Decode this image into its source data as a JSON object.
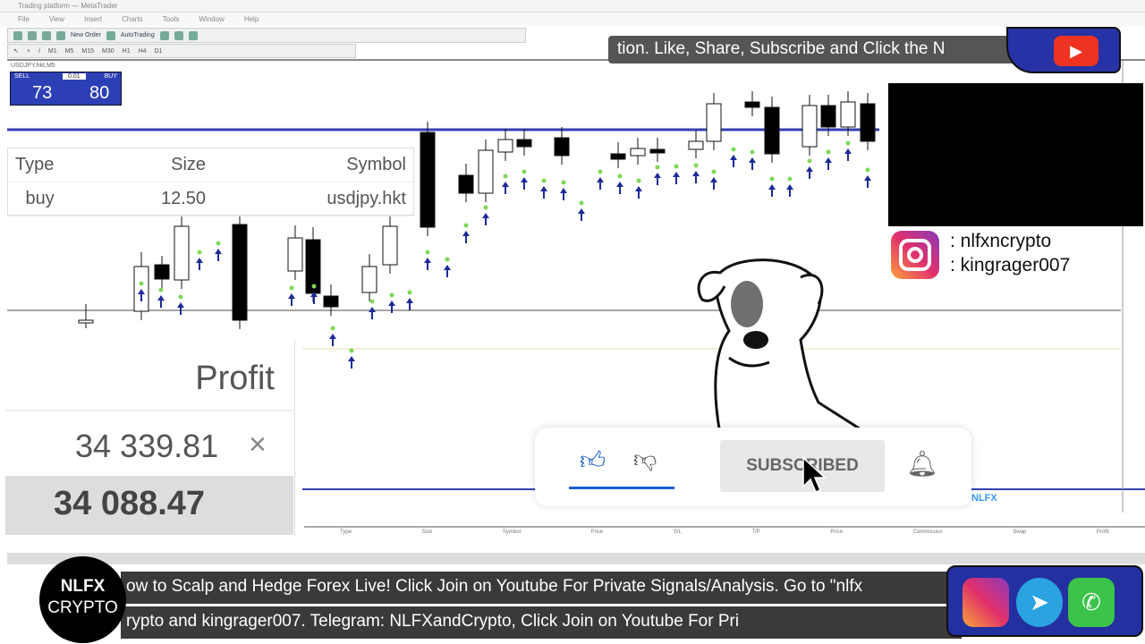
{
  "window": {
    "title": "Trading platform — MetaTrader",
    "menu": [
      "File",
      "View",
      "Insert",
      "Charts",
      "Tools",
      "Window",
      "Help"
    ]
  },
  "toolbar": {
    "new_order": "New Order",
    "autotrading": "AutoTrading",
    "timeframes": [
      "M1",
      "M5",
      "M15",
      "M30",
      "H1",
      "H4",
      "D1"
    ]
  },
  "chart": {
    "symbol_line": "USDJPY.hkt,M5",
    "sell_label": "SELL",
    "buy_label": "BUY",
    "lot": "0.01",
    "sell_price": "73",
    "buy_price": "80",
    "colors": {
      "bull": "#ffffff",
      "bear": "#000000",
      "arrow": "#1c2a9a",
      "arrow_tip": "#7ed957",
      "hline": "#3340b0"
    }
  },
  "trade_table": {
    "headers": [
      "Type",
      "Size",
      "Symbol"
    ],
    "row": [
      "buy",
      "12.50",
      "usdjpy.hkt"
    ]
  },
  "profit_panel": {
    "header": "Profit",
    "value": "34 339.81",
    "close_icon": "×",
    "total": "34 088.47"
  },
  "banner": {
    "text": "tion.  Like, Share, Subscribe and Click the N"
  },
  "instagram": {
    "handles": [
      ": nlfxncrypto",
      ": kingrager007"
    ]
  },
  "subscribe_widget": {
    "button": "SUBSCRIBED",
    "watermark": "NLFX"
  },
  "ticker": {
    "line1": "ow to Scalp and Hedge Forex Live! Click Join on Youtube For Private Signals/Analysis. Go to \"nlfx",
    "line2": "rypto and kingrager007.  Telegram: NLFXandCrypto,  Click Join on Youtube For Pri"
  },
  "logo": {
    "line1": "NLFX",
    "line2": "CRYPTO"
  },
  "terminal": {
    "headers": [
      "Type",
      "Size",
      "Symbol",
      "Price",
      "S/L",
      "T/P",
      "Price",
      "Commission",
      "Swap",
      "Profit"
    ]
  }
}
